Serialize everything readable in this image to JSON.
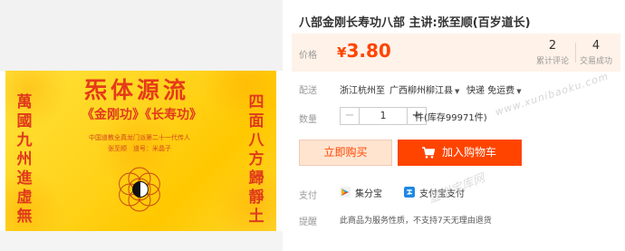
{
  "product": {
    "title": "八部金刚长寿功八部 主讲:张至顺(百岁道长)"
  },
  "image": {
    "card_title": "炁体源流",
    "card_subtitle": "《金刚功》《长寿功》",
    "card_line1": "中国道教全真龙门派第二十一代传人",
    "card_line2": "张至顺　道号：米晶子",
    "left_vertical": "萬國九州進虛無",
    "right_vertical": "四面八方歸靜土"
  },
  "price": {
    "label": "价格",
    "currency": "¥",
    "amount": "3.80",
    "reviews_count": "2",
    "reviews_label": "累计评论",
    "sales_count": "4",
    "sales_label": "交易成功"
  },
  "shipping": {
    "label": "配送",
    "from": "浙江杭州",
    "to_word": "至",
    "destination": "广西柳州柳江县",
    "method": "快递 免运费"
  },
  "quantity": {
    "label": "数量",
    "minus": "−",
    "value": "1",
    "plus": "+",
    "stock": "件(库存99971件)"
  },
  "actions": {
    "buy_now": "立即购买",
    "add_to_cart": "加入购物车"
  },
  "payment": {
    "label": "支付",
    "method1": "集分宝",
    "method2": "支付宝支付",
    "method1_color": "#2a9ee8",
    "method2_color": "#1e88e5"
  },
  "tip": {
    "label": "提醒",
    "text": "此商品为服务性质，不支持7天无理由退货"
  },
  "watermark": {
    "text": "www.xunibaoku.com",
    "text2": "虚拟宝库网"
  },
  "colors": {
    "accent": "#ff4400",
    "price_bg": "#fff2e8",
    "card_red": "#e03a1c"
  }
}
